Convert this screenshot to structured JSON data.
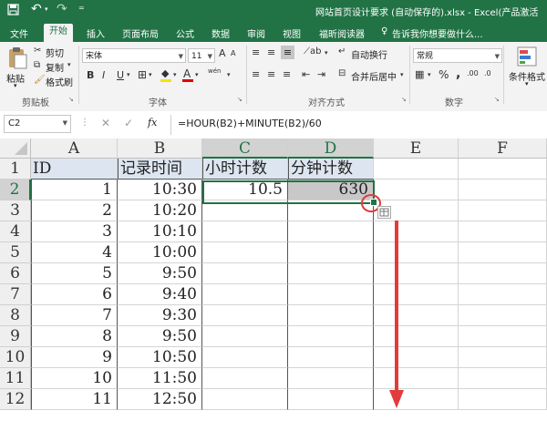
{
  "titlebar": {
    "title": "网站首页设计要求 (自动保存的).xlsx - Excel(产品激活"
  },
  "tabs": [
    "文件",
    "开始",
    "插入",
    "页面布局",
    "公式",
    "数据",
    "审阅",
    "视图",
    "福昕阅读器"
  ],
  "tell_me": "告诉我你想要做什么...",
  "ribbon": {
    "clipboard": {
      "paste": "粘贴",
      "cut": "剪切",
      "copy": "复制",
      "format_painter": "格式刷",
      "group": "剪贴板"
    },
    "font": {
      "name": "宋体",
      "size": "11",
      "bold": "B",
      "italic": "I",
      "underline": "U",
      "grow": "A",
      "shrink": "A",
      "font_color": "A",
      "wen": "wén",
      "group": "字体"
    },
    "alignment": {
      "wrap": "自动换行",
      "merge": "合并后居中",
      "group": "对齐方式"
    },
    "number": {
      "format": "常规",
      "percent": "%",
      "comma": ",",
      "inc_dec": ".00",
      "dec_dec": ".0",
      "group": "数字"
    },
    "styles": {
      "conditional": "条件格式"
    }
  },
  "formula_bar": {
    "cell_ref": "C2",
    "fx": "fx",
    "formula": "=HOUR(B2)+MINUTE(B2)/60"
  },
  "sheet": {
    "columns": [
      "A",
      "B",
      "C",
      "D",
      "E",
      "F"
    ],
    "rows": [
      "1",
      "2",
      "3",
      "4",
      "5",
      "6",
      "7",
      "8",
      "9",
      "10",
      "11",
      "12"
    ],
    "headers": [
      "ID",
      "记录时间",
      "小时计数",
      "分钟计数"
    ],
    "data": [
      {
        "id": "1",
        "time": "10:30",
        "hours": "10.5",
        "minutes": "630"
      },
      {
        "id": "2",
        "time": "10:20",
        "hours": "",
        "minutes": ""
      },
      {
        "id": "3",
        "time": "10:10",
        "hours": "",
        "minutes": ""
      },
      {
        "id": "4",
        "time": "10:00",
        "hours": "",
        "minutes": ""
      },
      {
        "id": "5",
        "time": "9:50",
        "hours": "",
        "minutes": ""
      },
      {
        "id": "6",
        "time": "9:40",
        "hours": "",
        "minutes": ""
      },
      {
        "id": "7",
        "time": "9:30",
        "hours": "",
        "minutes": ""
      },
      {
        "id": "8",
        "time": "9:50",
        "hours": "",
        "minutes": ""
      },
      {
        "id": "9",
        "time": "10:50",
        "hours": "",
        "minutes": ""
      },
      {
        "id": "10",
        "time": "11:50",
        "hours": "",
        "minutes": ""
      },
      {
        "id": "11",
        "time": "12:50",
        "hours": "",
        "minutes": ""
      }
    ]
  },
  "colors": {
    "excel_green": "#217346",
    "annotation_red": "#e23b3b",
    "header_fill": "#dde6f0",
    "selected_fill": "#c8c8c8"
  }
}
